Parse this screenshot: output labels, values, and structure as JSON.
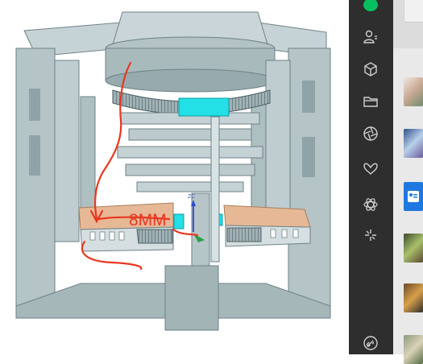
{
  "cad_view": {
    "annotation_text": "8MM",
    "axis_label": "ZC",
    "colors": {
      "body": "#b9c8cb",
      "body_dark": "#8fa3a8",
      "edge": "#5e7276",
      "plate": "#e7b896",
      "highlight": "#22e0e6",
      "markup": "#e8371f",
      "axis": "#2a49d6"
    }
  },
  "sidebar": {
    "background": "#2e2e2e",
    "items": [
      {
        "icon": "chat-icon",
        "active": true
      },
      {
        "icon": "contacts-icon"
      },
      {
        "icon": "cube-icon"
      },
      {
        "icon": "folder-icon"
      },
      {
        "icon": "aperture-icon"
      },
      {
        "icon": "butterfly-icon"
      },
      {
        "icon": "atom-icon"
      },
      {
        "icon": "sparkle-icon"
      },
      {
        "icon": "link-icon"
      }
    ]
  },
  "chat_list": {
    "items": [
      {
        "thumb": "avatar-1"
      },
      {
        "thumb": "avatar-2"
      },
      {
        "thumb": "avatar-3"
      },
      {
        "thumb": "avatar-4"
      },
      {
        "thumb": "avatar-5"
      },
      {
        "thumb": "avatar-6"
      },
      {
        "thumb": "avatar-7"
      },
      {
        "thumb": "avatar-8"
      }
    ]
  }
}
